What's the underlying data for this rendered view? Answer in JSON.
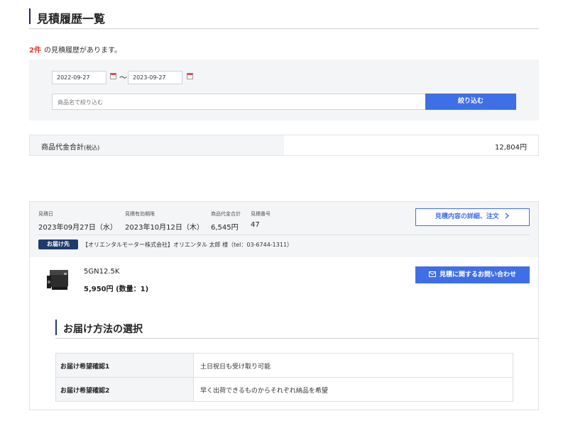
{
  "page": {
    "title": "見積履歴一覧"
  },
  "summary": {
    "count": "2件",
    "text": "の見積履歴があります。"
  },
  "filter": {
    "date_from": "2022-09-27",
    "date_to": "2023-09-27",
    "separator": "〜",
    "search_placeholder": "商品名で絞り込む",
    "search_button": "絞り込む"
  },
  "total": {
    "label": "商品代金合計",
    "label_suffix": "(税込)",
    "value": "12,804円"
  },
  "quote": {
    "meta": [
      {
        "key": "見積日",
        "value": "2023年09月27日（水）"
      },
      {
        "key": "見積有効期限",
        "value": "2023年10月12日（木）"
      },
      {
        "key": "商品代金合計",
        "value": "6,545円"
      },
      {
        "key": "見積番号",
        "value": "47"
      }
    ],
    "detail_button": "見積内容の詳細、注文",
    "destination_badge": "お届け先",
    "destination_text": "【オリエンタルモーター株式会社】オリエンタル 太郎 様（tel：03-6744-1311）",
    "product": {
      "name": "5GN12.5K",
      "price": "5,950円 (数量：1)"
    },
    "inquiry_button": "見積に関するお問い合わせ",
    "delivery": {
      "title": "お届け方法の選択",
      "rows": [
        {
          "key": "お届け希望確認1",
          "value": "土日祝日も受け取り可能"
        },
        {
          "key": "お届け希望確認2",
          "value": "早く出荷できるものからそれぞれ納品を希望"
        }
      ]
    }
  },
  "colors": {
    "accent": "#3f6fe6",
    "count_red": "#e53935",
    "badge_navy": "#1f3a6e"
  }
}
